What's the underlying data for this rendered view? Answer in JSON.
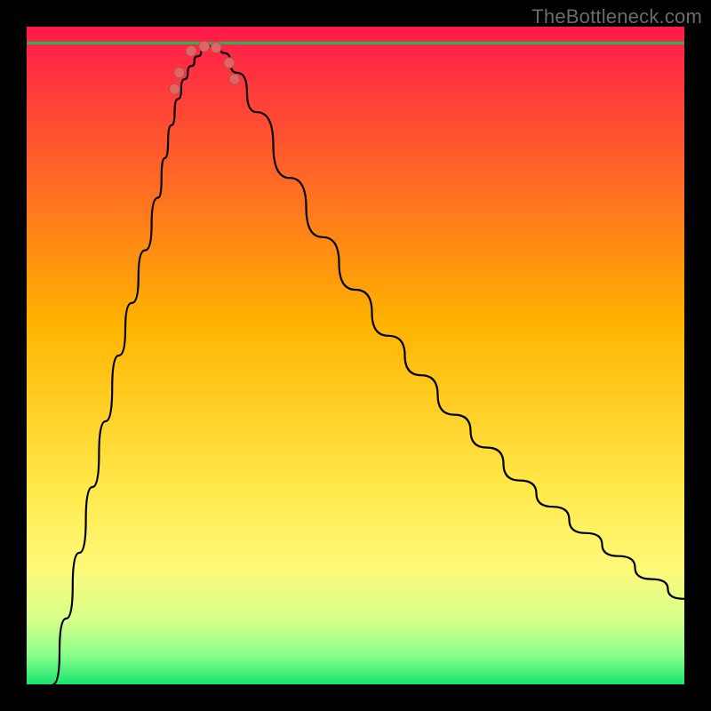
{
  "watermark": "TheBottleneck.com",
  "chart_data": {
    "type": "line",
    "title": "",
    "xlabel": "",
    "ylabel": "",
    "xlim": [
      0,
      100
    ],
    "ylim": [
      0,
      100
    ],
    "grid": false,
    "legend": null,
    "gradient_stops": [
      {
        "offset": 0.0,
        "color": "#ff1a4b"
      },
      {
        "offset": 0.45,
        "color": "#ffb300"
      },
      {
        "offset": 0.7,
        "color": "#ffe94a"
      },
      {
        "offset": 0.82,
        "color": "#fff978"
      },
      {
        "offset": 0.9,
        "color": "#d8ff8a"
      },
      {
        "offset": 0.955,
        "color": "#8bff8b"
      },
      {
        "offset": 1.0,
        "color": "#19e36e"
      }
    ],
    "baseline_y": 97.5,
    "series": [
      {
        "name": "bottleneck-curve",
        "x": [
          4,
          6,
          8,
          10,
          12,
          14,
          16,
          18,
          20,
          21,
          22,
          23,
          24,
          25,
          26,
          27,
          28,
          29,
          30,
          32,
          35,
          40,
          45,
          50,
          55,
          60,
          65,
          70,
          75,
          80,
          85,
          90,
          95,
          100
        ],
        "values": [
          0,
          10,
          20,
          30,
          40,
          50,
          58,
          66,
          74,
          80,
          85,
          89,
          92,
          94,
          95.5,
          96.5,
          97,
          97,
          96,
          93,
          87,
          77,
          68,
          60,
          53,
          47,
          41,
          36,
          31,
          27,
          23,
          19.5,
          16,
          13
        ]
      }
    ],
    "markers": [
      {
        "x": 22.5,
        "y": 90.5,
        "r": 6
      },
      {
        "x": 23.2,
        "y": 93.0,
        "r": 6
      },
      {
        "x": 25.0,
        "y": 96.3,
        "r": 6
      },
      {
        "x": 27.0,
        "y": 97.0,
        "r": 6
      },
      {
        "x": 28.8,
        "y": 96.8,
        "r": 6
      },
      {
        "x": 30.8,
        "y": 94.5,
        "r": 6
      },
      {
        "x": 31.6,
        "y": 92.0,
        "r": 6
      }
    ],
    "marker_color": "#e06666",
    "marker_stroke": "#b84a4a"
  }
}
